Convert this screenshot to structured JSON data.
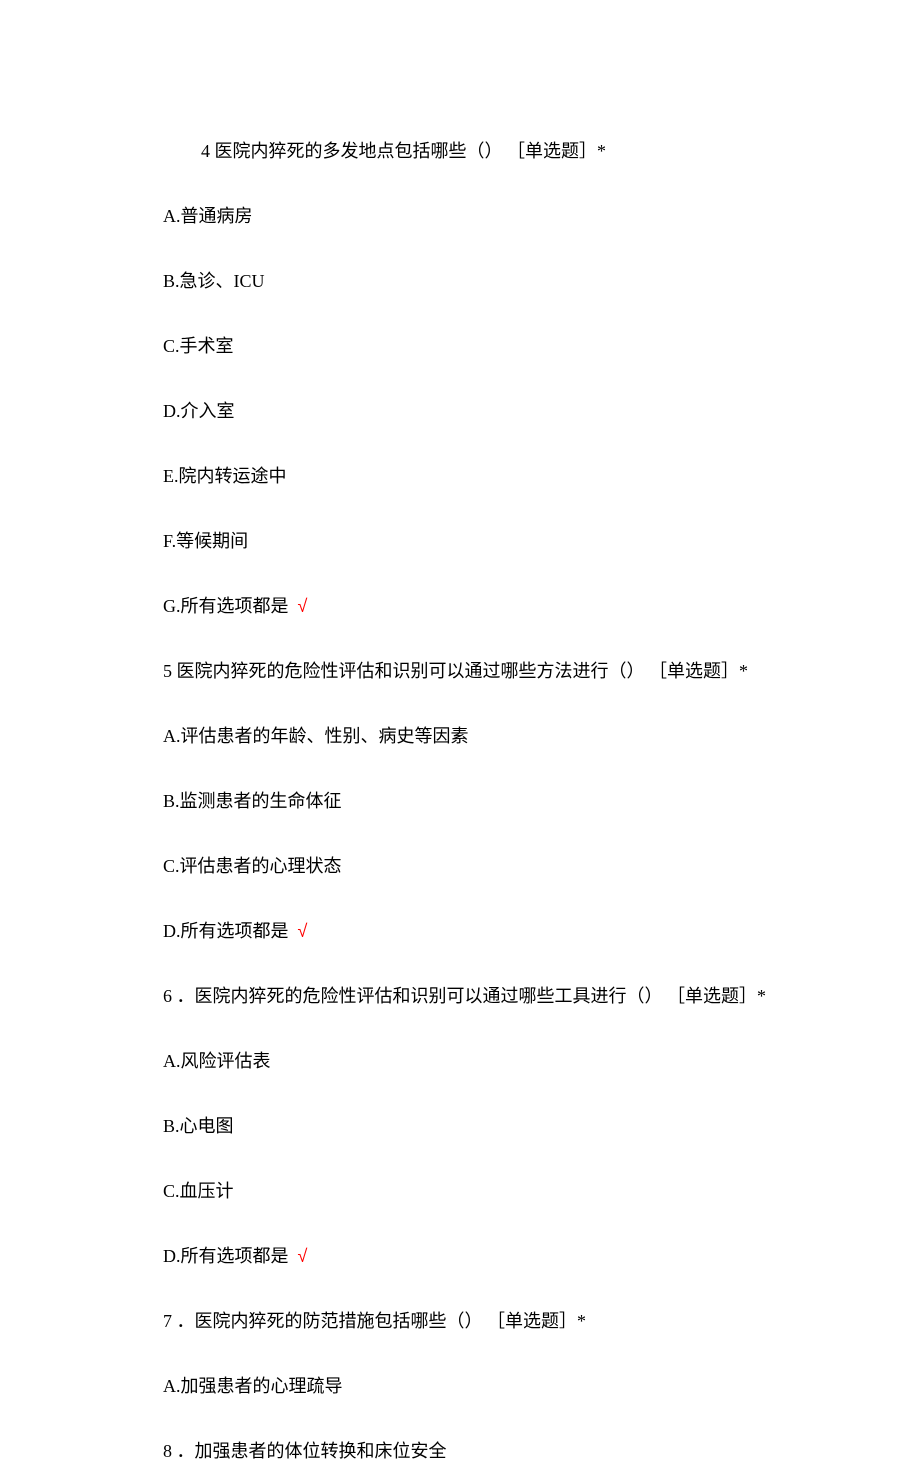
{
  "q4": {
    "text": "4 医院内猝死的多发地点包括哪些（） ［单选题］*",
    "options": {
      "a": "A.普通病房",
      "b": "B.急诊、ICU",
      "c": "C.手术室",
      "d": "D.介入室",
      "e": "E.院内转运途中",
      "f": "F.等候期间",
      "g": "G.所有选项都是"
    },
    "mark": " √"
  },
  "q5": {
    "text": "5 医院内猝死的危险性评估和识别可以通过哪些方法进行（） ［单选题］*",
    "options": {
      "a": "A.评估患者的年龄、性别、病史等因素",
      "b": "B.监测患者的生命体征",
      "c": "C.评估患者的心理状态",
      "d": "D.所有选项都是"
    },
    "mark": " √"
  },
  "q6": {
    "text": "6 ．医院内猝死的危险性评估和识别可以通过哪些工具进行（） ［单选题］*",
    "options": {
      "a": "A.风险评估表",
      "b": "B.心电图",
      "c": "C.血压计",
      "d": "D.所有选项都是"
    },
    "mark": " √"
  },
  "q7": {
    "text": "7 ．医院内猝死的防范措施包括哪些（） ［单选题］*",
    "options": {
      "a": "A.加强患者的心理疏导"
    }
  },
  "q8": {
    "text": "8 ．加强患者的体位转换和床位安全"
  }
}
